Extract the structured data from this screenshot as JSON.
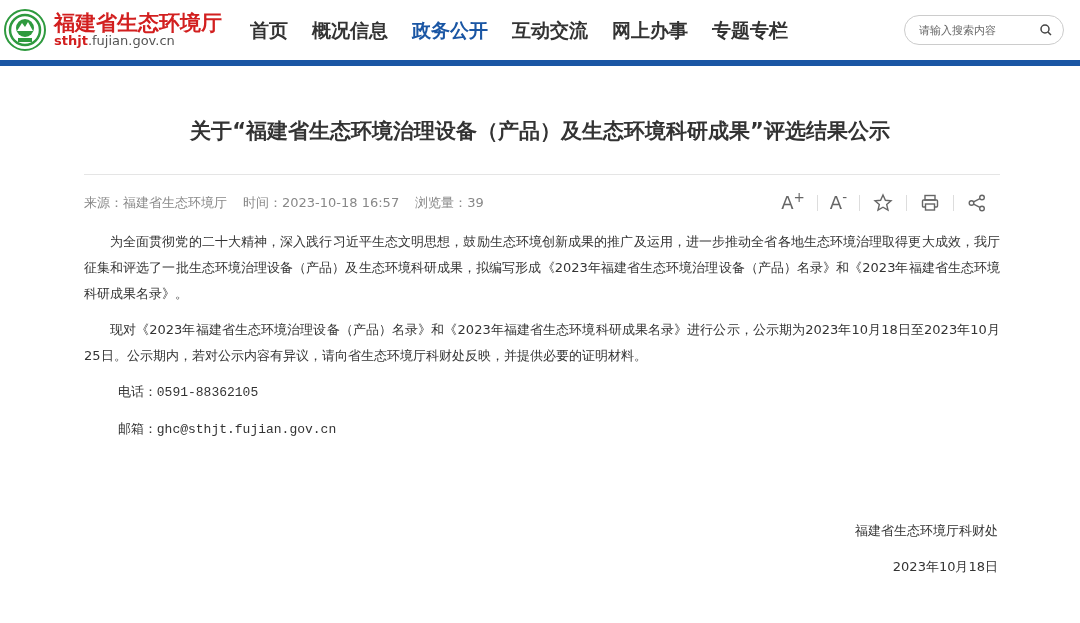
{
  "header": {
    "site_name": "福建省生态环境厅",
    "domain_highlight": "sthjt",
    "domain_rest": ".fujian.gov.cn",
    "nav": [
      {
        "label": "首页",
        "selected": false
      },
      {
        "label": "概况信息",
        "selected": false
      },
      {
        "label": "政务公开",
        "selected": true
      },
      {
        "label": "互动交流",
        "selected": false
      },
      {
        "label": "网上办事",
        "selected": false
      },
      {
        "label": "专题专栏",
        "selected": false
      }
    ],
    "search": {
      "placeholder": "请输入搜索内容"
    }
  },
  "article": {
    "title": "关于“福建省生态环境治理设备（产品）及生态环境科研成果”评选结果公示",
    "meta": [
      "来源：福建省生态环境厅",
      "时间：2023-10-18 16:57",
      "浏览量：39"
    ],
    "tools": [
      {
        "kind": "text",
        "label": "A$^{+}$"
      },
      {
        "kind": "text",
        "label": "A$^{-}$"
      },
      {
        "kind": "star"
      },
      {
        "kind": "print"
      },
      {
        "kind": "share"
      }
    ],
    "paragraphs": [
      {
        "kind": "body",
        "text": "为全面贯彻党的二十大精神，深入践行习近平生态文明思想，鼓励生态环境创新成果的推广及运用，进一步推动全省各地生态环境治理取得更大成效，我厅征集和评选了一批生态环境治理设备（产品）及生态环境科研成果，拟编写形成《2023年福建省生态环境治理设备（产品）名录》和《2023年福建省生态环境科研成果名录》。"
      },
      {
        "kind": "body",
        "text": "现对《2023年福建省生态环境治理设备（产品）名录》和《2023年福建省生态环境科研成果名录》进行公示，公示期为2023年10月18日至2023年10月25日。公示期内，若对公示内容有异议，请向省生态环境厅科财处反映，并提供必要的证明材料。"
      },
      {
        "kind": "contact",
        "text": "电话：0591-88362105"
      },
      {
        "kind": "contact",
        "text": "邮箱：ghc@sthjt.fujian.gov.cn"
      }
    ],
    "signature": [
      "福建省生态环境厅科财处",
      "2023年10月18日"
    ]
  }
}
